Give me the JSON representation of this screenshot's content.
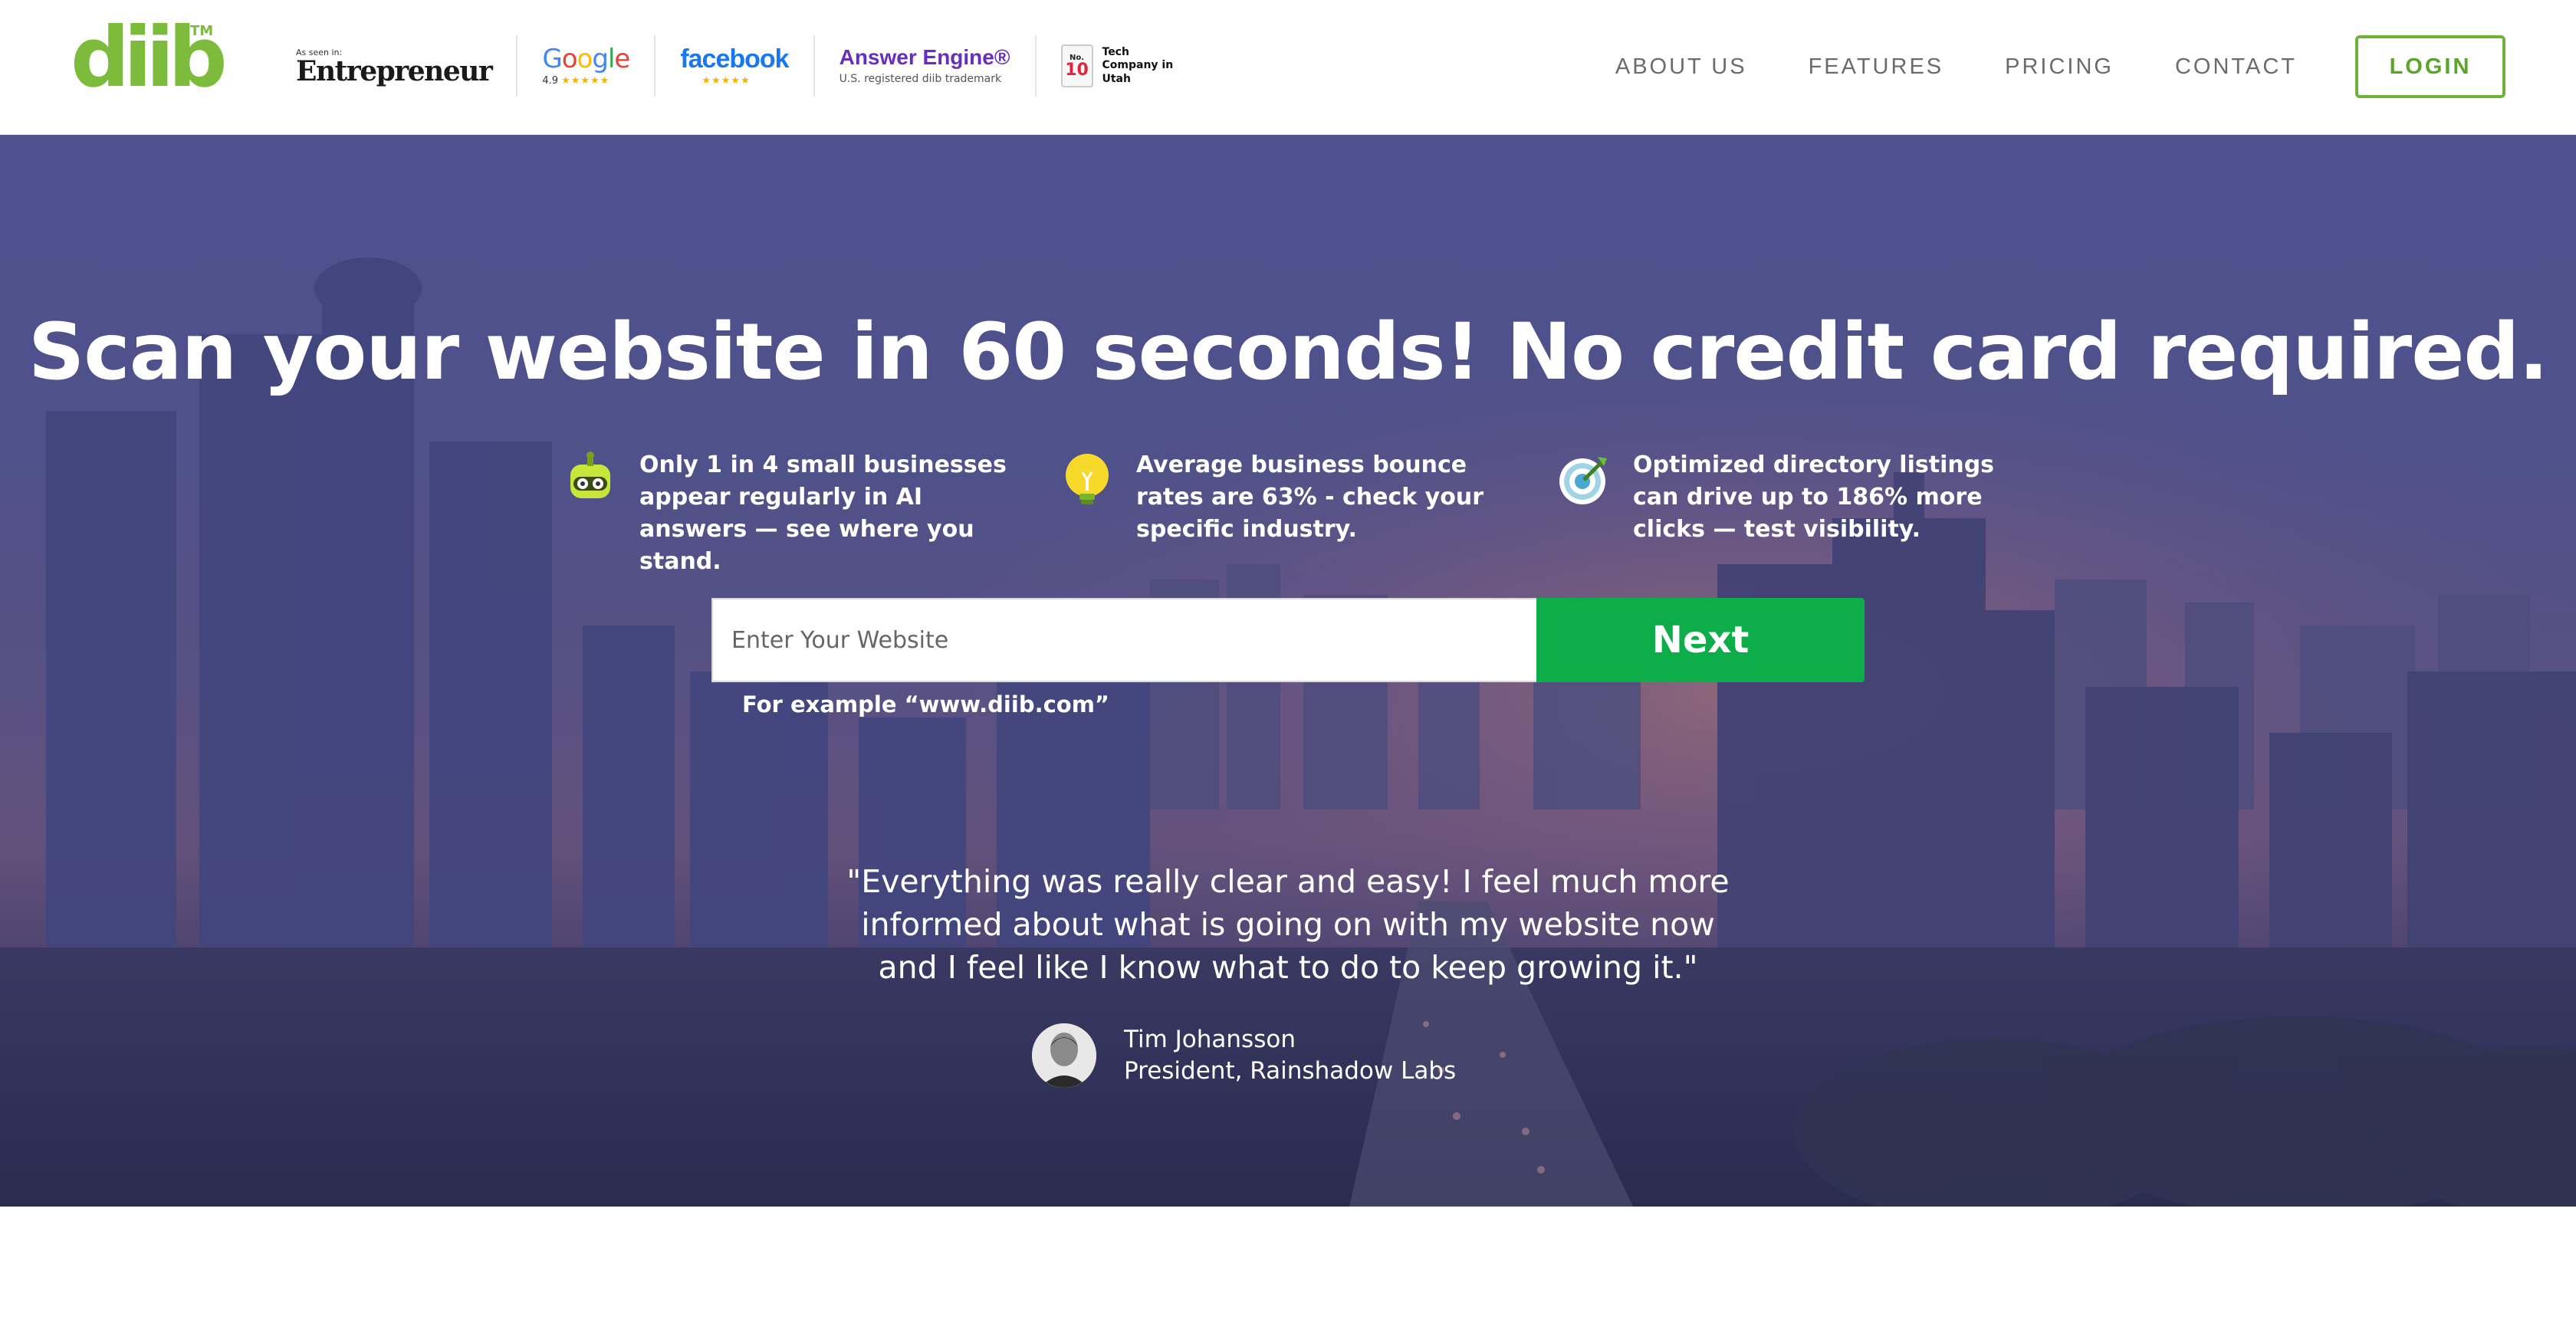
{
  "brand": {
    "logo_text": "diib",
    "trademark": "TM"
  },
  "badges": {
    "entrepreneur_caption": "As seen in:",
    "entrepreneur_name": "Entrepreneur",
    "google_letters": [
      "G",
      "o",
      "o",
      "g",
      "l",
      "e"
    ],
    "google_rating": "4.9",
    "stars": "★★★★★",
    "facebook_name": "facebook",
    "answer_engine_name": "Answer Engine®",
    "answer_engine_sub": "U.S. registered diib trademark",
    "tech_no_label": "No.",
    "tech_number": "10",
    "tech_text": "Tech Company in Utah"
  },
  "nav": {
    "items": [
      "ABOUT US",
      "FEATURES",
      "PRICING",
      "CONTACT"
    ],
    "login_label": "LOGIN"
  },
  "hero": {
    "title": "Scan your website in 60 seconds! No credit card required.",
    "features": [
      {
        "icon": "robot-icon",
        "text": "Only  1 in 4 small businesses appear regularly in AI answers — see where you stand."
      },
      {
        "icon": "lightbulb-icon",
        "text": "Average business bounce rates are 63% - check your specific industry."
      },
      {
        "icon": "target-icon",
        "text": "Optimized directory listings can drive up to 186% more clicks — test visibility."
      }
    ],
    "search": {
      "placeholder": "Enter Your Website",
      "value": "",
      "button_label": "Next",
      "example_hint": "For example “www.diib.com”"
    },
    "testimonial": {
      "quote": "\"Everything was really clear and easy! I feel much more informed about what is going on with my website now and I feel like I know what to do to keep growing it.\"",
      "author_name": "Tim Johansson",
      "author_title": "President, Rainshadow Labs"
    }
  },
  "colors": {
    "brand_green": "#7dbb3c",
    "cta_green": "#0dad4a",
    "nav_text": "#6b6b6b",
    "hero_tint": "#5a5f9e"
  }
}
